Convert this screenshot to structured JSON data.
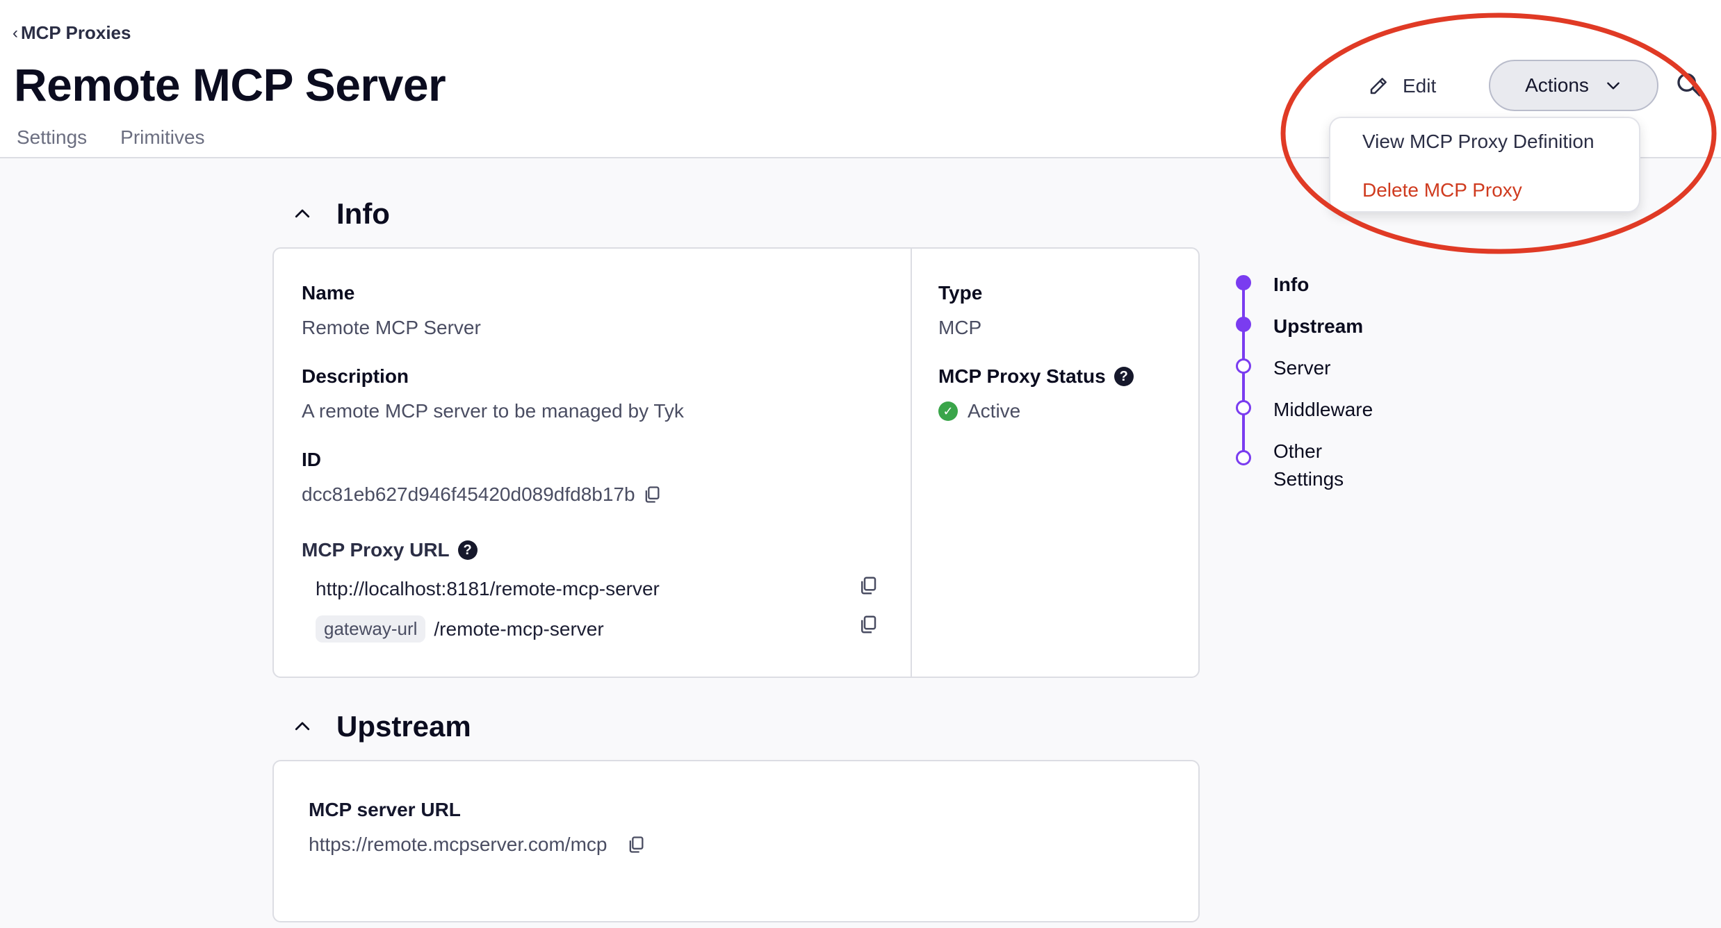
{
  "breadcrumb": {
    "chevron": "‹",
    "label": "MCP Proxies"
  },
  "page": {
    "title": "Remote MCP Server"
  },
  "tabs": [
    {
      "label": "Settings"
    },
    {
      "label": "Primitives"
    }
  ],
  "toolbar": {
    "edit_label": "Edit",
    "actions_label": "Actions",
    "edit_icon": "pencil-icon",
    "search_icon": "search-icon"
  },
  "actions_menu": {
    "items": [
      {
        "label": "View MCP Proxy Definition"
      },
      {
        "label": "Delete MCP Proxy",
        "color": "#cf3b1f"
      }
    ]
  },
  "sections": {
    "info": {
      "title": "Info",
      "name_label": "Name",
      "name_value": "Remote MCP Server",
      "description_label": "Description",
      "description_value": "A remote MCP server to be managed by Tyk",
      "id_label": "ID",
      "id_value": "dcc81eb627d946f45420d089dfd8b17b",
      "proxy_url_label": "MCP Proxy URL",
      "proxy_url_full": "http://localhost:8181/remote-mcp-server",
      "proxy_url_chip": "gateway-url",
      "proxy_url_path": "/remote-mcp-server",
      "type_label": "Type",
      "type_value": "MCP",
      "status_label": "MCP Proxy Status",
      "status_value": "Active",
      "status_color": "#3aa54a"
    },
    "upstream": {
      "title": "Upstream",
      "server_url_label": "MCP server URL",
      "server_url_value": "https://remote.mcpserver.com/mcp"
    }
  },
  "anchor_nav": {
    "accent": "#7a3cf0",
    "items": [
      {
        "label": "Info",
        "state": "filled"
      },
      {
        "label": "Upstream",
        "state": "filled"
      },
      {
        "label": "Server",
        "state": "hollow"
      },
      {
        "label": "Middleware",
        "state": "hollow"
      },
      {
        "label": "Other Settings",
        "state": "hollow"
      }
    ]
  },
  "annotation": {
    "ring_color": "#e03a25"
  }
}
